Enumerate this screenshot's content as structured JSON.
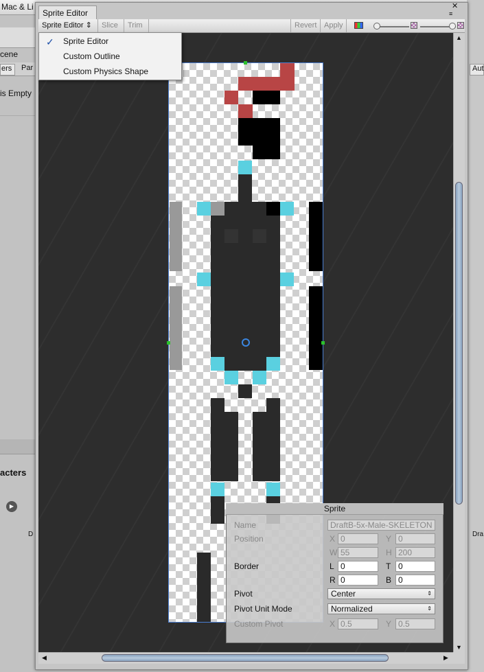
{
  "background": {
    "title": "Mac & Li",
    "scene_label": "cene",
    "tab1": "ers",
    "tab2": "Par",
    "empty_label": "is Empty",
    "characters_label": "acters",
    "play_icon": "play-icon",
    "d_label": "D",
    "auto_tab": "Aut",
    "dra_label": "Dra"
  },
  "window": {
    "tab_title": "Sprite Editor",
    "close_glyph": "✕",
    "menu_glyph": "≡"
  },
  "toolbar": {
    "mode_label": "Sprite Editor ⇕",
    "slice_label": "Slice ⇕",
    "trim_label": "Trim",
    "revert_label": "Revert",
    "apply_label": "Apply"
  },
  "dropdown": {
    "items": [
      "Sprite Editor",
      "Custom Outline",
      "Custom Physics Shape"
    ],
    "checked": "Sprite Editor",
    "check_glyph": "✓"
  },
  "sprite_panel": {
    "title": "Sprite",
    "name_label": "Name",
    "name_value": "DraftB-5x-Male-SKELETON",
    "position_label": "Position",
    "x_label": "X",
    "x_value": "0",
    "y_label": "Y",
    "y_value": "0",
    "w_label": "W",
    "w_value": "55",
    "h_label": "H",
    "h_value": "200",
    "border_label": "Border",
    "l_label": "L",
    "l_value": "0",
    "t_label": "T",
    "t_value": "0",
    "r_label": "R",
    "r_value": "0",
    "b_label": "B",
    "b_value": "0",
    "pivot_label": "Pivot",
    "pivot_value": "Center",
    "pivot_unit_label": "Pivot Unit Mode",
    "pivot_unit_value": "Normalized",
    "custom_pivot_label": "Custom Pivot",
    "cpx_label": "X",
    "cpx_value": "0.5",
    "cpy_label": "Y",
    "cpy_value": "0.5",
    "select_arrow": "⇕"
  },
  "scroll": {
    "up": "▲",
    "down": "▼",
    "left": "◀",
    "right": "▶"
  },
  "colors": {
    "canvas": "#2d2d2d",
    "selection": "#4a7fd4",
    "accent_cyan": "#5ad0e0",
    "red_pixel": "#b84545"
  }
}
